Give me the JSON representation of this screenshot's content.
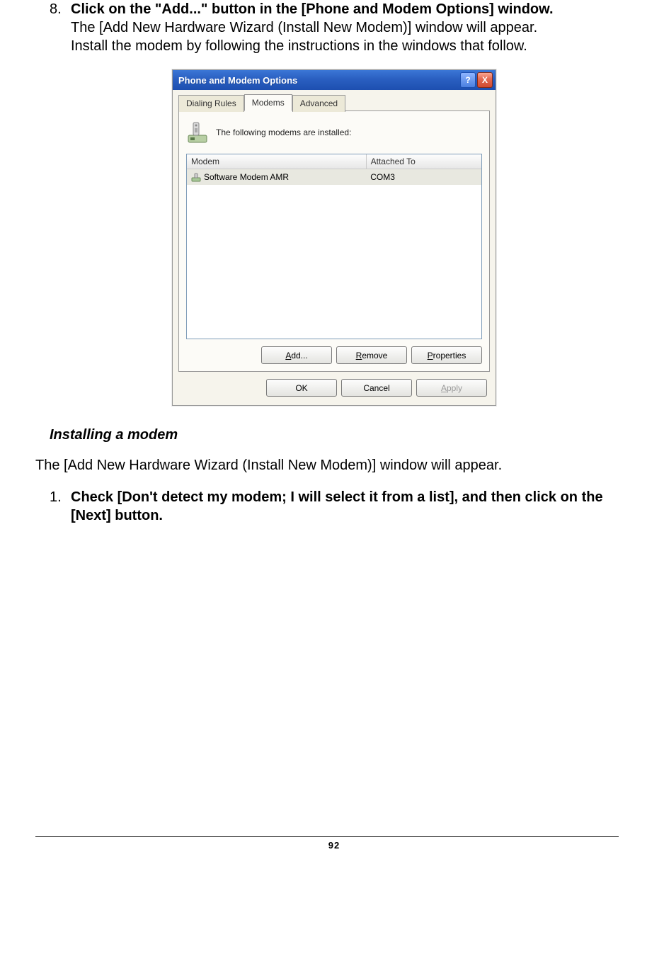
{
  "step8": {
    "number": "8.",
    "bold": "Click on the \"Add...\" button in the [Phone and Modem Options] window.",
    "line2": "The [Add New Hardware Wizard (Install New Modem)] window will appear.",
    "line3": "Install the modem by following the instructions in the windows that follow."
  },
  "dialog": {
    "title": "Phone and Modem Options",
    "help": "?",
    "close": "X",
    "tabs": {
      "dialing": "Dialing Rules",
      "modems": "Modems",
      "advanced": "Advanced"
    },
    "info": "The following modems are  installed:",
    "columns": {
      "modem": "Modem",
      "attached": "Attached To"
    },
    "row": {
      "modem": "Software Modem AMR",
      "attached": "COM3"
    },
    "buttons": {
      "add_pre": "A",
      "add_post": "dd...",
      "remove_pre": "R",
      "remove_post": "emove",
      "props_pre": "P",
      "props_post": "roperties",
      "ok": "OK",
      "cancel": "Cancel",
      "apply_pre": "A",
      "apply_post": "pply"
    }
  },
  "subheading": "Installing a modem",
  "para": "The [Add New Hardware Wizard (Install New Modem)] window will appear.",
  "step1": {
    "number": "1.",
    "bold": "Check [Don't detect my modem; I will select it from a list], and then click on the [Next] button."
  },
  "pageNumber": "92"
}
